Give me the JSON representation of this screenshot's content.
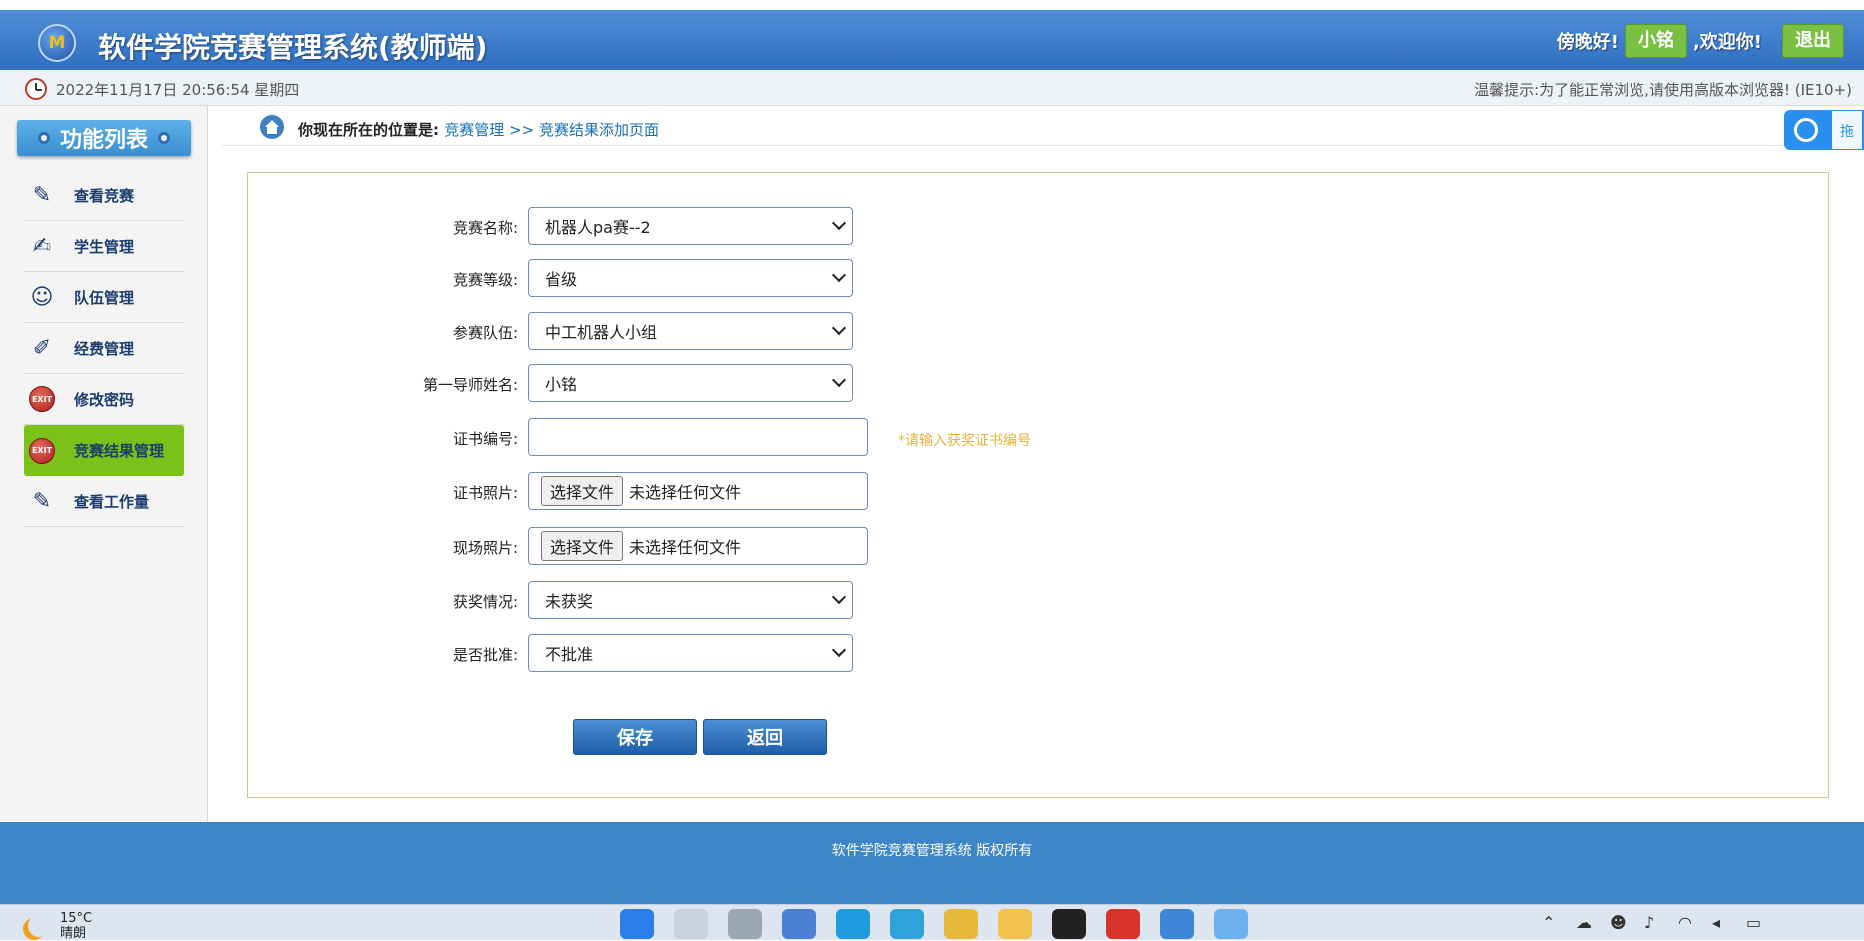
{
  "header": {
    "logo_text": "M",
    "title": "软件学院竞赛管理系统(教师端)",
    "greeting": "傍晚好!",
    "user_name": "小铭",
    "welcome": ",欢迎你!",
    "logout_label": "退出"
  },
  "infobar": {
    "datetime": "2022年11月17日 20:56:54 星期四",
    "tip": "温馨提示:为了能正常浏览,请使用高版本浏览器! (IE10+)"
  },
  "sidebar": {
    "title": "功能列表",
    "items": [
      {
        "label": "查看竞赛",
        "icon": "pencil-book-icon"
      },
      {
        "label": "学生管理",
        "icon": "student-chart-icon"
      },
      {
        "label": "队伍管理",
        "icon": "team-users-icon"
      },
      {
        "label": "经费管理",
        "icon": "edit-notebook-icon"
      },
      {
        "label": "修改密码",
        "icon": "exit-icon"
      },
      {
        "label": "竞赛结果管理",
        "icon": "exit-icon"
      },
      {
        "label": "查看工作量",
        "icon": "pencil-book-icon"
      }
    ],
    "exit_badge": "EXIT"
  },
  "breadcrumb": {
    "prefix": "你现在所在的位置是:",
    "level1": "竞赛管理",
    "separator": " >> ",
    "level2": "竞赛结果添加页面"
  },
  "float_button": {
    "label": "拖"
  },
  "form": {
    "competition_name": {
      "label": "竞赛名称:",
      "value": "机器人pa赛--2"
    },
    "competition_level": {
      "label": "竞赛等级:",
      "value": "省级"
    },
    "team": {
      "label": "参赛队伍:",
      "value": "中工机器人小组"
    },
    "first_advisor": {
      "label": "第一导师姓名:",
      "value": "小铭"
    },
    "certificate_no": {
      "label": "证书编号:",
      "value": "",
      "hint": "*请输入获奖证书编号"
    },
    "certificate_photo": {
      "label": "证书照片:",
      "button": "选择文件",
      "status": "未选择任何文件"
    },
    "site_photo": {
      "label": "现场照片:",
      "button": "选择文件",
      "status": "未选择任何文件"
    },
    "award": {
      "label": "获奖情况:",
      "value": "未获奖"
    },
    "approved": {
      "label": "是否批准:",
      "value": "不批准"
    },
    "save_label": "保存",
    "back_label": "返回"
  },
  "footer": {
    "text": "软件学院竞赛管理系统 版权所有"
  },
  "taskbar": {
    "temperature": "15°C",
    "weather": "晴朗"
  },
  "colors": {
    "header_blue": "#3a7ccb",
    "active_green": "#7ac21a",
    "footer_blue": "#3f86c8",
    "hint_yellow": "#e0b43a"
  }
}
